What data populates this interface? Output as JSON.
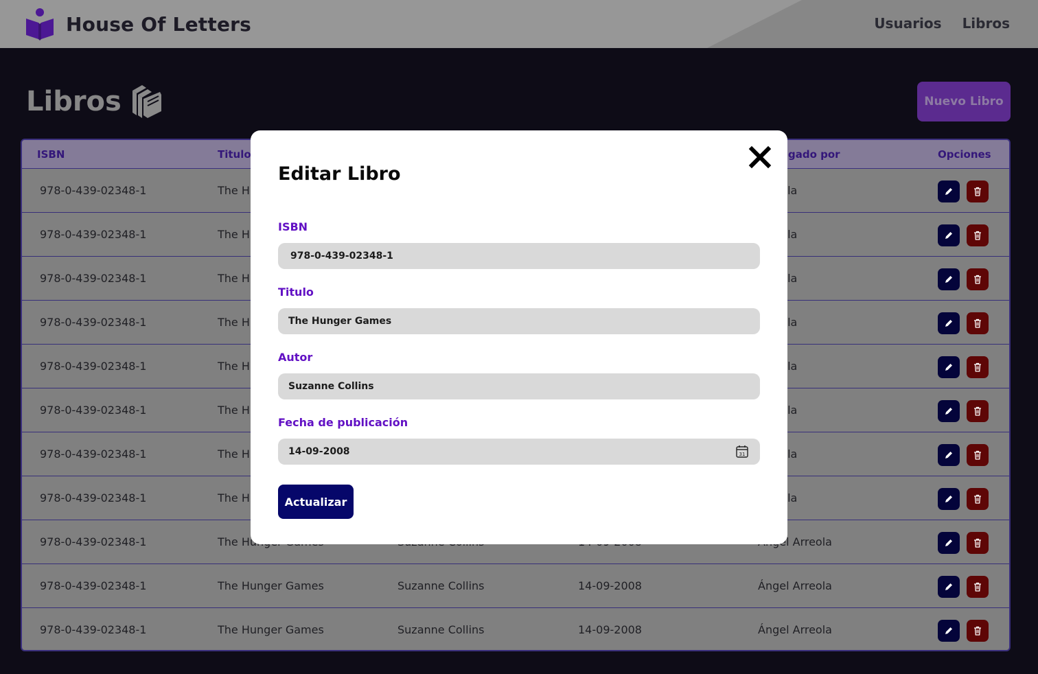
{
  "header": {
    "brand_name": "House Of Letters",
    "nav": [
      "Usuarios",
      "Libros"
    ]
  },
  "page": {
    "title": "Libros",
    "new_button": "Nuevo Libro"
  },
  "table": {
    "columns": [
      "ISBN",
      "Titulo",
      "Autor",
      "Fecha de publicación",
      "Agregado por",
      "Opciones"
    ],
    "visible_headers": {
      "isbn": "ISBN",
      "titulo": "Titulo",
      "agregado": "gado por",
      "opciones": "Opciones"
    },
    "rows": [
      {
        "isbn": "978-0-439-02348-1",
        "titulo": "The Hu",
        "autor": "",
        "fecha": "",
        "agregado": "Arreola"
      },
      {
        "isbn": "978-0-439-02348-1",
        "titulo": "The Hu",
        "autor": "",
        "fecha": "",
        "agregado": "Arreola"
      },
      {
        "isbn": "978-0-439-02348-1",
        "titulo": "The Hu",
        "autor": "",
        "fecha": "",
        "agregado": "Arreola"
      },
      {
        "isbn": "978-0-439-02348-1",
        "titulo": "The Hu",
        "autor": "",
        "fecha": "",
        "agregado": "Arreola"
      },
      {
        "isbn": "978-0-439-02348-1",
        "titulo": "The Hu",
        "autor": "",
        "fecha": "",
        "agregado": "Arreola"
      },
      {
        "isbn": "978-0-439-02348-1",
        "titulo": "The Hu",
        "autor": "",
        "fecha": "",
        "agregado": "Arreola"
      },
      {
        "isbn": "978-0-439-02348-1",
        "titulo": "The Hu",
        "autor": "",
        "fecha": "",
        "agregado": "Arreola"
      },
      {
        "isbn": "978-0-439-02348-1",
        "titulo": "The Hu",
        "autor": "",
        "fecha": "",
        "agregado": "Arreola"
      },
      {
        "isbn": "978-0-439-02348-1",
        "titulo": "The Hunger Games",
        "autor": "Suzanne Collins",
        "fecha": "14-09-2008",
        "agregado": "Ángel Arreola"
      },
      {
        "isbn": "978-0-439-02348-1",
        "titulo": "The Hunger Games",
        "autor": "Suzanne Collins",
        "fecha": "14-09-2008",
        "agregado": "Ángel Arreola"
      },
      {
        "isbn": "978-0-439-02348-1",
        "titulo": "The Hunger Games",
        "autor": "Suzanne Collins",
        "fecha": "14-09-2008",
        "agregado": "Ángel Arreola"
      }
    ]
  },
  "modal": {
    "title": "Editar Libro",
    "fields": {
      "isbn": {
        "label": "ISBN",
        "value": "978-0-439-02348-1"
      },
      "titulo": {
        "label": "Titulo",
        "value": "The Hunger Games"
      },
      "autor": {
        "label": "Autor",
        "value": "Suzanne Collins"
      },
      "fecha": {
        "label": "Fecha de publicación",
        "value": "14-09-2008"
      }
    },
    "calendar_day": "31",
    "submit_label": "Actualizar"
  },
  "colors": {
    "accent_purple": "#6211c4",
    "brand_purple": "#5b2b8f",
    "navy_button": "#06076a",
    "delete_red": "#5e0606",
    "page_bg": "#0e0c17"
  },
  "icons": {
    "brand": "book-reader-icon",
    "title": "books-icon",
    "edit": "pencil-icon",
    "delete": "trash-icon",
    "close": "close-icon",
    "date": "calendar-icon"
  }
}
